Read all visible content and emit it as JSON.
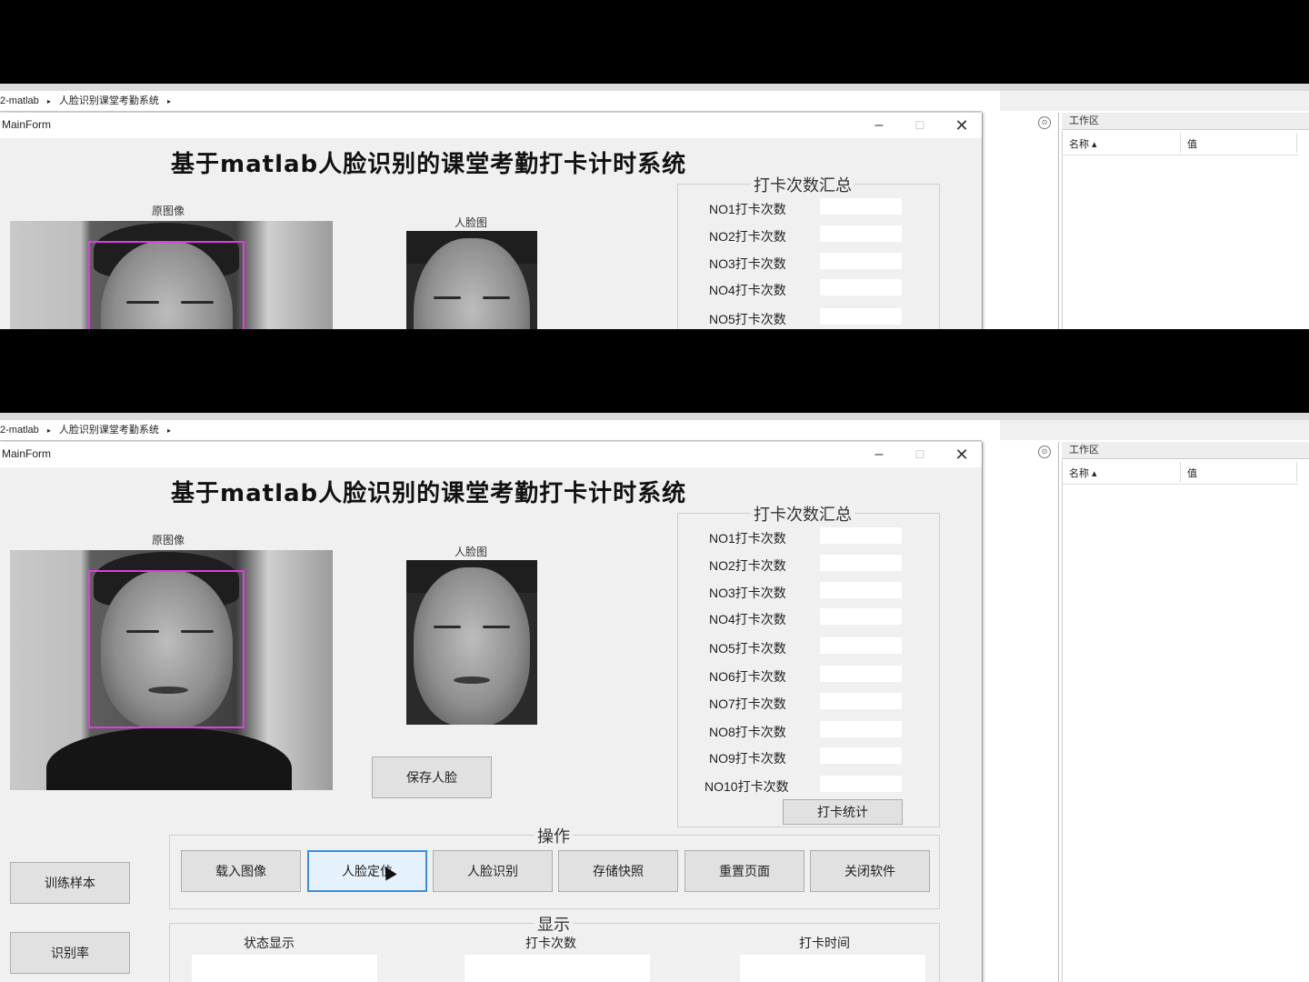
{
  "matlab": {
    "breadcrumb": [
      "2-matlab",
      "人脸识别课堂考勤系统"
    ],
    "workspace_title": "工作区",
    "workspace_col_name": "名称 ▴",
    "workspace_col_value": "值"
  },
  "window": {
    "title": "MainForm",
    "min_glyph": "–",
    "max_glyph": "☐",
    "close_glyph": "✕"
  },
  "app": {
    "title": "基于matlab人脸识别的课堂考勤打卡计时系统",
    "original_caption": "原图像",
    "face_caption": "人脸图",
    "save_face_label": "保存人脸",
    "counts_group_title": "打卡次数汇总",
    "count_labels": [
      "NO1打卡次数",
      "NO2打卡次数",
      "NO3打卡次数",
      "NO4打卡次数",
      "NO5打卡次数",
      "NO6打卡次数",
      "NO7打卡次数",
      "NO8打卡次数",
      "NO9打卡次数",
      "NO10打卡次数"
    ],
    "stats_button_label": "打卡统计",
    "ops_group_title": "操作",
    "ops_buttons": [
      "载入图像",
      "人脸定位",
      "人脸识别",
      "存储快照",
      "重置页面",
      "关闭软件"
    ],
    "train_button_label": "训练样本",
    "recog_rate_button_label": "识别率",
    "display_group_title": "显示",
    "status_label": "状态显示",
    "count_label": "打卡次数",
    "time_label": "打卡时间"
  },
  "colors": {
    "detection_box": "#e03ce0",
    "active_button_border": "#3c8fd6"
  }
}
